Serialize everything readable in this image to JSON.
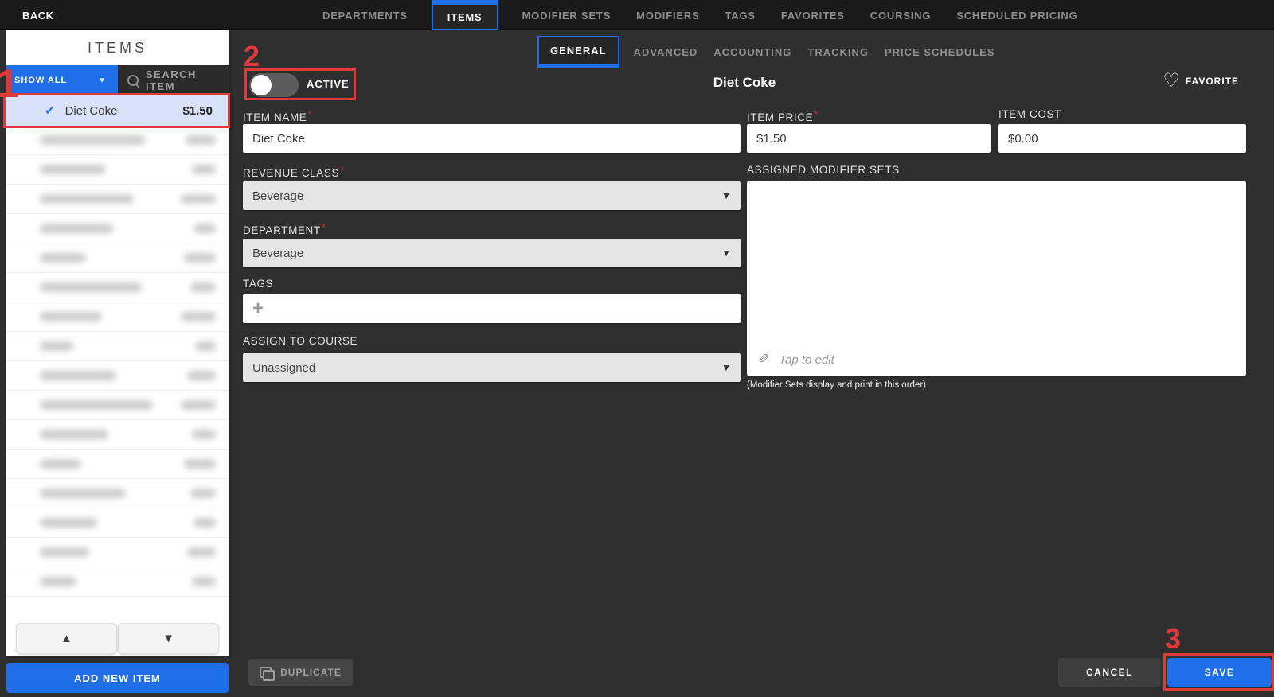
{
  "topbar": {
    "back_label": "BACK",
    "tabs": [
      {
        "label": "DEPARTMENTS",
        "active": false
      },
      {
        "label": "ITEMS",
        "active": true
      },
      {
        "label": "MODIFIER SETS",
        "active": false
      },
      {
        "label": "MODIFIERS",
        "active": false
      },
      {
        "label": "TAGS",
        "active": false
      },
      {
        "label": "FAVORITES",
        "active": false
      },
      {
        "label": "COURSING",
        "active": false
      },
      {
        "label": "SCHEDULED PRICING",
        "active": false
      }
    ]
  },
  "sidebar": {
    "title": "ITEMS",
    "filter_label": "SHOW ALL",
    "search_placeholder": "SEARCH ITEM",
    "selected_item": {
      "name": "Diet Coke",
      "price": "$1.50"
    },
    "redacted_rows": [
      {
        "name_w": 132,
        "price_w": 38
      },
      {
        "name_w": 82,
        "price_w": 30
      },
      {
        "name_w": 118,
        "price_w": 44
      },
      {
        "name_w": 92,
        "price_w": 28
      },
      {
        "name_w": 58,
        "price_w": 40
      },
      {
        "name_w": 128,
        "price_w": 32
      },
      {
        "name_w": 78,
        "price_w": 44
      },
      {
        "name_w": 42,
        "price_w": 26
      },
      {
        "name_w": 96,
        "price_w": 36
      },
      {
        "name_w": 142,
        "price_w": 44
      },
      {
        "name_w": 86,
        "price_w": 30
      },
      {
        "name_w": 52,
        "price_w": 40
      },
      {
        "name_w": 108,
        "price_w": 32
      },
      {
        "name_w": 72,
        "price_w": 28
      },
      {
        "name_w": 62,
        "price_w": 36
      },
      {
        "name_w": 46,
        "price_w": 30
      }
    ],
    "add_item_label": "ADD NEW ITEM"
  },
  "content": {
    "tabs": [
      {
        "label": "GENERAL",
        "active": true
      },
      {
        "label": "ADVANCED",
        "active": false
      },
      {
        "label": "ACCOUNTING",
        "active": false
      },
      {
        "label": "TRACKING",
        "active": false
      },
      {
        "label": "PRICE SCHEDULES",
        "active": false
      }
    ],
    "active_toggle": {
      "label": "ACTIVE",
      "on": false
    },
    "title": "Diet Coke",
    "favorite_label": "FAVORITE",
    "required_mark": "*",
    "fields": {
      "item_name": {
        "label": "ITEM NAME",
        "value": "Diet Coke"
      },
      "item_price": {
        "label": "ITEM PRICE",
        "value": "$1.50"
      },
      "item_cost": {
        "label": "ITEM COST",
        "value": "$0.00"
      },
      "revenue_class": {
        "label": "REVENUE CLASS",
        "value": "Beverage"
      },
      "department": {
        "label": "DEPARTMENT",
        "value": "Beverage"
      },
      "tags": {
        "label": "TAGS",
        "add_symbol": "+"
      },
      "assign_to_course": {
        "label": "ASSIGN TO COURSE",
        "value": "Unassigned"
      },
      "assigned_modifier_sets": {
        "label": "ASSIGNED MODIFIER SETS",
        "empty_hint": "Tap to edit",
        "caption": "(Modifier Sets display and print in this order)"
      }
    },
    "buttons": {
      "duplicate": "DUPLICATE",
      "cancel": "CANCEL",
      "save": "SAVE"
    }
  },
  "annotations": {
    "step1": "1",
    "step2": "2",
    "step3": "3"
  },
  "icons": {
    "heart": "♡",
    "pencil": "✎",
    "check": "✔",
    "caret_down": "▼",
    "arrow_up": "▲",
    "arrow_down": "▼"
  },
  "colors": {
    "accent_blue": "#1f6fe8",
    "annotation_red": "#de3a3c",
    "selected_row": "#d9e2f8"
  }
}
